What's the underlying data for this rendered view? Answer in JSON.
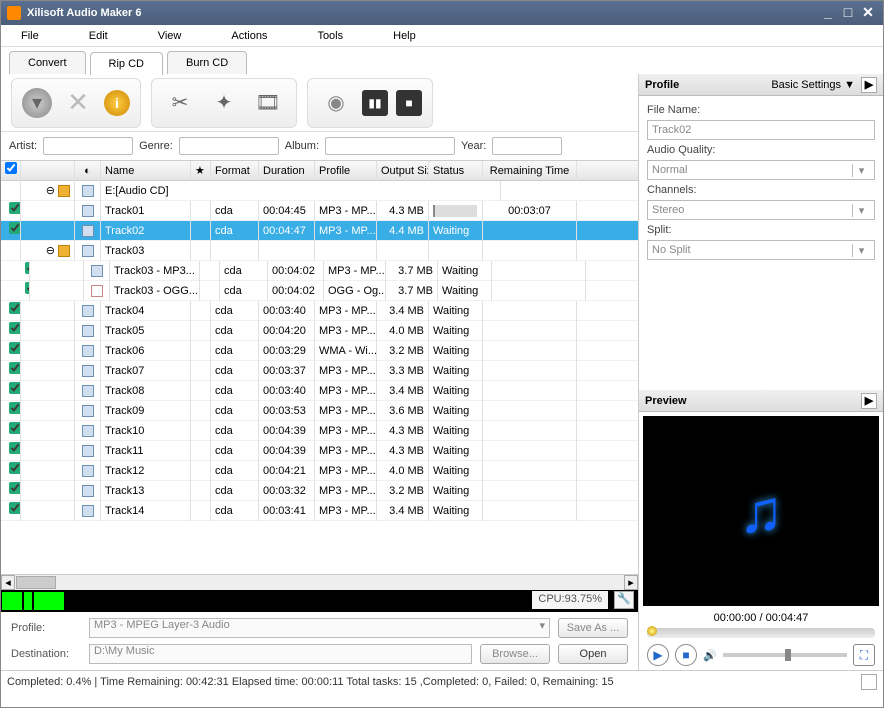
{
  "window": {
    "title": "Xilisoft Audio Maker 6"
  },
  "menu": [
    "File",
    "Edit",
    "View",
    "Actions",
    "Tools",
    "Help"
  ],
  "tabs": {
    "items": [
      "Convert",
      "Rip CD",
      "Burn CD"
    ],
    "active": 1
  },
  "meta": {
    "artist_label": "Artist:",
    "artist": "",
    "genre_label": "Genre:",
    "genre": "",
    "album_label": "Album:",
    "album": "",
    "year_label": "Year:",
    "year": ""
  },
  "columns": {
    "name": "Name",
    "format": "Format",
    "duration": "Duration",
    "profile": "Profile",
    "output_size": "Output Size",
    "status": "Status",
    "remaining": "Remaining Time"
  },
  "root": {
    "label": "E:[Audio CD]"
  },
  "rows": [
    {
      "checked": true,
      "icon": "audio",
      "name": "Track01",
      "format": "cda",
      "duration": "00:04:45",
      "profile": "MP3 - MP...",
      "size": "4.3 MB",
      "status_progress": "5.6%",
      "remaining": "00:03:07",
      "indent": 1
    },
    {
      "checked": true,
      "icon": "audio",
      "name": "Track02",
      "format": "cda",
      "duration": "00:04:47",
      "profile": "MP3 - MP...",
      "size": "4.4 MB",
      "status": "Waiting",
      "indent": 1,
      "selected": true
    },
    {
      "checked": null,
      "icon": "audio",
      "name": "Track03",
      "indent": 1,
      "expander": "minus",
      "folder": true
    },
    {
      "checked": true,
      "icon": "audio",
      "name": "Track03 - MP3...",
      "format": "cda",
      "duration": "00:04:02",
      "profile": "MP3 - MP...",
      "size": "3.7 MB",
      "status": "Waiting",
      "indent": 2
    },
    {
      "checked": true,
      "icon": "doc",
      "name": "Track03 - OGG...",
      "format": "cda",
      "duration": "00:04:02",
      "profile": "OGG - Og...",
      "size": "3.7 MB",
      "status": "Waiting",
      "indent": 2
    },
    {
      "checked": true,
      "icon": "audio",
      "name": "Track04",
      "format": "cda",
      "duration": "00:03:40",
      "profile": "MP3 - MP...",
      "size": "3.4 MB",
      "status": "Waiting",
      "indent": 1
    },
    {
      "checked": true,
      "icon": "audio",
      "name": "Track05",
      "format": "cda",
      "duration": "00:04:20",
      "profile": "MP3 - MP...",
      "size": "4.0 MB",
      "status": "Waiting",
      "indent": 1
    },
    {
      "checked": true,
      "icon": "audio",
      "name": "Track06",
      "format": "cda",
      "duration": "00:03:29",
      "profile": "WMA - Wi...",
      "size": "3.2 MB",
      "status": "Waiting",
      "indent": 1
    },
    {
      "checked": true,
      "icon": "audio",
      "name": "Track07",
      "format": "cda",
      "duration": "00:03:37",
      "profile": "MP3 - MP...",
      "size": "3.3 MB",
      "status": "Waiting",
      "indent": 1
    },
    {
      "checked": true,
      "icon": "audio",
      "name": "Track08",
      "format": "cda",
      "duration": "00:03:40",
      "profile": "MP3 - MP...",
      "size": "3.4 MB",
      "status": "Waiting",
      "indent": 1
    },
    {
      "checked": true,
      "icon": "audio",
      "name": "Track09",
      "format": "cda",
      "duration": "00:03:53",
      "profile": "MP3 - MP...",
      "size": "3.6 MB",
      "status": "Waiting",
      "indent": 1
    },
    {
      "checked": true,
      "icon": "audio",
      "name": "Track10",
      "format": "cda",
      "duration": "00:04:39",
      "profile": "MP3 - MP...",
      "size": "4.3 MB",
      "status": "Waiting",
      "indent": 1
    },
    {
      "checked": true,
      "icon": "audio",
      "name": "Track11",
      "format": "cda",
      "duration": "00:04:39",
      "profile": "MP3 - MP...",
      "size": "4.3 MB",
      "status": "Waiting",
      "indent": 1
    },
    {
      "checked": true,
      "icon": "audio",
      "name": "Track12",
      "format": "cda",
      "duration": "00:04:21",
      "profile": "MP3 - MP...",
      "size": "4.0 MB",
      "status": "Waiting",
      "indent": 1
    },
    {
      "checked": true,
      "icon": "audio",
      "name": "Track13",
      "format": "cda",
      "duration": "00:03:32",
      "profile": "MP3 - MP...",
      "size": "3.2 MB",
      "status": "Waiting",
      "indent": 1
    },
    {
      "checked": true,
      "icon": "audio",
      "name": "Track14",
      "format": "cda",
      "duration": "00:03:41",
      "profile": "MP3 - MP...",
      "size": "3.4 MB",
      "status": "Waiting",
      "indent": 1
    }
  ],
  "cpu": {
    "label": "CPU:93.75%"
  },
  "bottom": {
    "profile_label": "Profile:",
    "profile_value": "MP3 - MPEG Layer-3 Audio",
    "saveas": "Save As ...",
    "dest_label": "Destination:",
    "dest_value": "D:\\My Music",
    "browse": "Browse...",
    "open": "Open"
  },
  "status": {
    "text": "Completed: 0.4% | Time Remaining: 00:42:31 Elapsed time: 00:00:11 Total tasks: 15 ,Completed: 0, Failed: 0, Remaining: 15"
  },
  "profile_panel": {
    "title": "Profile",
    "mode": "Basic Settings ▼",
    "filename_label": "File Name:",
    "filename": "Track02",
    "quality_label": "Audio Quality:",
    "quality": "Normal",
    "channels_label": "Channels:",
    "channels": "Stereo",
    "split_label": "Split:",
    "split": "No Split"
  },
  "preview": {
    "title": "Preview",
    "time": "00:00:00 / 00:04:47"
  }
}
